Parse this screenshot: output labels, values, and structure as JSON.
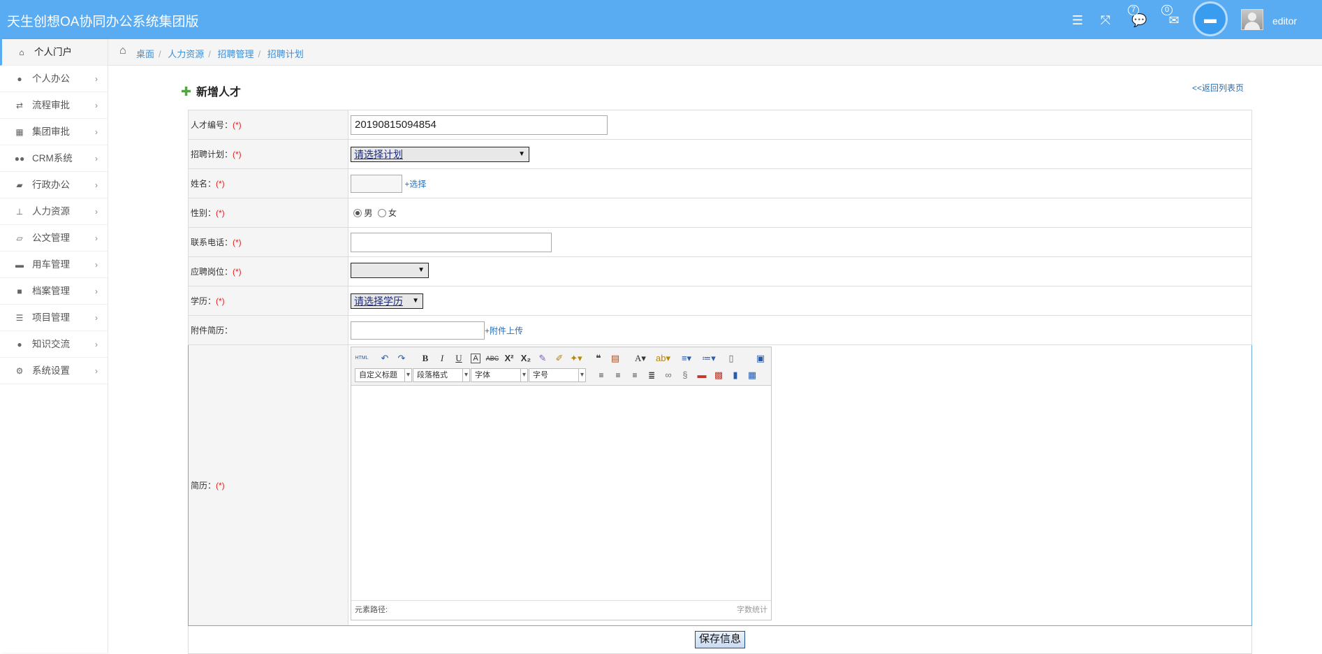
{
  "header": {
    "title": "天生创想OA协同办公系统集团版",
    "messages_count": "7",
    "mail_count": "0",
    "username": "editor"
  },
  "sidebar": {
    "items": [
      {
        "label": "个人门户",
        "icon": "home-icon"
      },
      {
        "label": "个人办公",
        "icon": "user-icon"
      },
      {
        "label": "流程审批",
        "icon": "retweet-icon"
      },
      {
        "label": "集团审批",
        "icon": "grid-icon"
      },
      {
        "label": "CRM系统",
        "icon": "users-icon"
      },
      {
        "label": "行政办公",
        "icon": "briefcase-icon"
      },
      {
        "label": "人力资源",
        "icon": "sitemap-icon"
      },
      {
        "label": "公文管理",
        "icon": "folder-open-icon"
      },
      {
        "label": "用车管理",
        "icon": "truck-icon"
      },
      {
        "label": "档案管理",
        "icon": "folder-icon"
      },
      {
        "label": "项目管理",
        "icon": "list-icon"
      },
      {
        "label": "知识交流",
        "icon": "comments-icon"
      },
      {
        "label": "系统设置",
        "icon": "cogs-icon"
      }
    ]
  },
  "breadcrumb": [
    "桌面",
    "人力资源",
    "招聘管理",
    "招聘计划"
  ],
  "form": {
    "title": "新增人才",
    "back_link": "<<返回列表页",
    "required_mark": "(*)",
    "rows": {
      "number": {
        "label": "人才编号：",
        "value": "20190815094854"
      },
      "plan": {
        "label": "招聘计划：",
        "selected": "请选择计划"
      },
      "name": {
        "label": "姓名：",
        "value": "",
        "select_link": "+选择"
      },
      "gender": {
        "label": "性别：",
        "options": [
          "男",
          "女"
        ],
        "selected": "男"
      },
      "phone": {
        "label": "联系电话：",
        "value": ""
      },
      "position": {
        "label": "应聘岗位：",
        "selected": ""
      },
      "education": {
        "label": "学历：",
        "selected": "请选择学历"
      },
      "attachment": {
        "label": "附件简历：",
        "value": "",
        "upload_link": "+附件上传"
      },
      "resume": {
        "label": "简历："
      }
    },
    "editor": {
      "html_label": "HTML",
      "dropdowns": [
        "自定义标题",
        "段落格式",
        "字体",
        "字号"
      ],
      "footer_path": "元素路径:",
      "footer_wordcount": "字数统计"
    },
    "save_label": "保存信息"
  }
}
